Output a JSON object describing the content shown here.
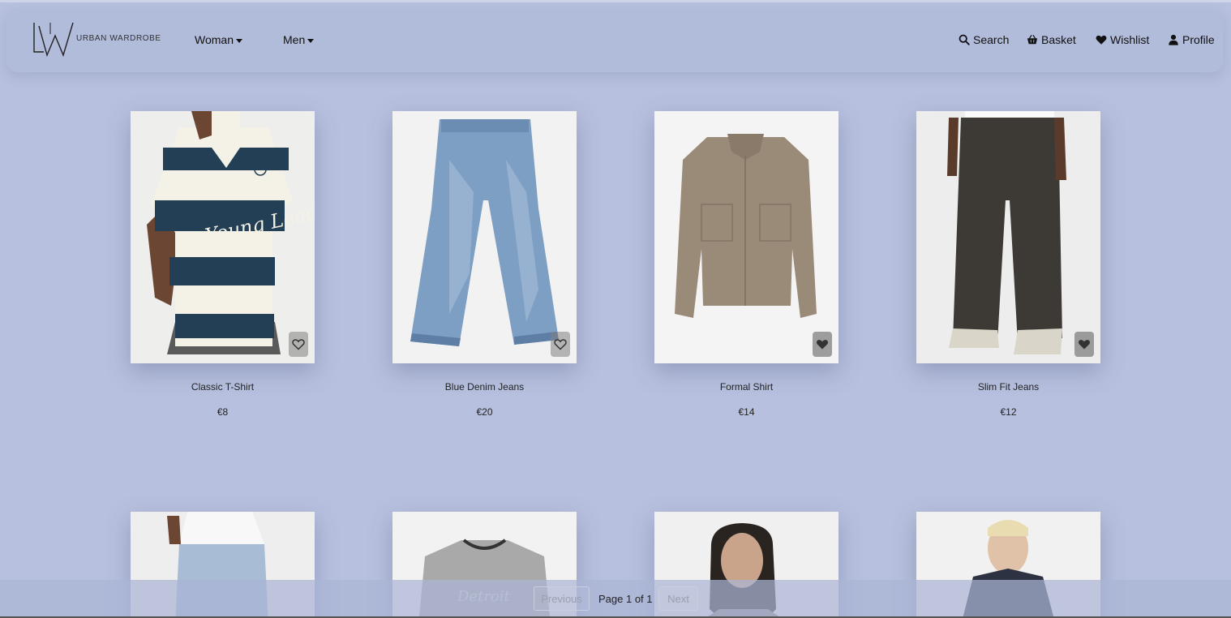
{
  "brand": {
    "name": "URBAN WARDROBE"
  },
  "nav": {
    "left": [
      {
        "label": "Woman"
      },
      {
        "label": "Men"
      }
    ],
    "right": [
      {
        "label": "Search",
        "icon": "search-icon"
      },
      {
        "label": "Basket",
        "icon": "basket-icon"
      },
      {
        "label": "Wishlist",
        "icon": "heart-icon"
      },
      {
        "label": "Profile",
        "icon": "user-icon"
      }
    ]
  },
  "products": [
    {
      "name": "Classic T-Shirt",
      "price": "€8",
      "wishlisted": false
    },
    {
      "name": "Blue Denim Jeans",
      "price": "€20",
      "wishlisted": false
    },
    {
      "name": "Formal Shirt",
      "price": "€14",
      "wishlisted": true
    },
    {
      "name": "Slim Fit Jeans",
      "price": "€12",
      "wishlisted": true
    }
  ],
  "pagination": {
    "previous": "Previous",
    "status": "Page 1 of 1",
    "next": "Next"
  },
  "colors": {
    "background": "#b7c0de",
    "navbar": "#b1bbda"
  }
}
